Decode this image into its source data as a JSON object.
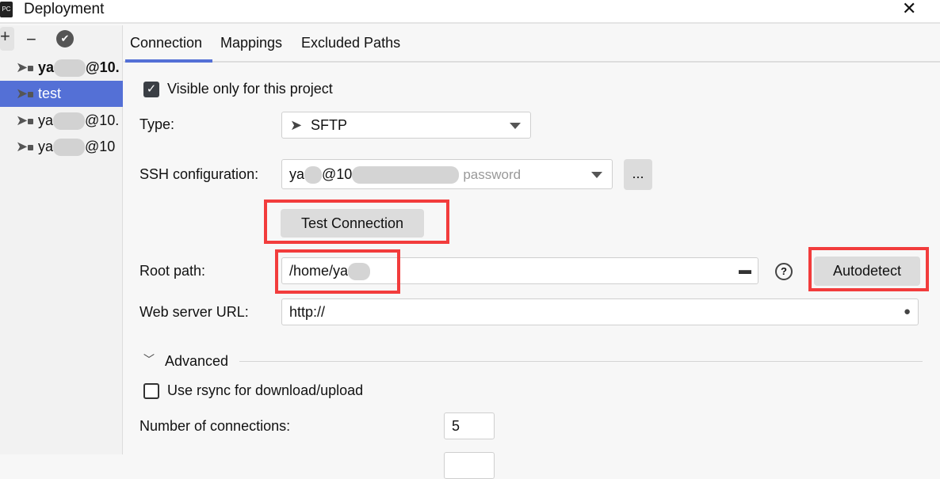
{
  "window": {
    "title": "Deployment",
    "app_icon": "PC",
    "close": "✕"
  },
  "sidebar": {
    "toolbar": {
      "add": "+",
      "remove": "−",
      "check": "✔"
    },
    "items": [
      {
        "label": "ya",
        "label_suffix": "@10.",
        "bold": true
      },
      {
        "label": "test",
        "selected": true
      },
      {
        "label": "ya",
        "label_suffix": "@10."
      },
      {
        "label": "ya",
        "label_suffix": "@10"
      }
    ]
  },
  "tabs": [
    {
      "label": "Connection",
      "active": true
    },
    {
      "label": "Mappings"
    },
    {
      "label": "Excluded Paths"
    }
  ],
  "form": {
    "visible_only": {
      "label": "Visible only for this project",
      "checked": true
    },
    "type": {
      "label": "Type:",
      "value": "SFTP"
    },
    "ssh": {
      "label": "SSH configuration:",
      "value_prefix": "ya",
      "value_mid": "@10",
      "hint": "password",
      "more": "..."
    },
    "test_connection": "Test Connection",
    "root_path": {
      "label": "Root path:",
      "value": "/home/ya",
      "help": "?",
      "autodetect": "Autodetect"
    },
    "web_url": {
      "label": "Web server URL:",
      "value": "http://"
    },
    "advanced": {
      "label": "Advanced",
      "expanded": true
    },
    "rsync": {
      "label": "Use rsync for download/upload",
      "checked": false
    },
    "connections": {
      "label": "Number of connections:",
      "value": "5"
    }
  },
  "colors": {
    "accent": "#5470d6",
    "highlight": "#f23c3c"
  }
}
